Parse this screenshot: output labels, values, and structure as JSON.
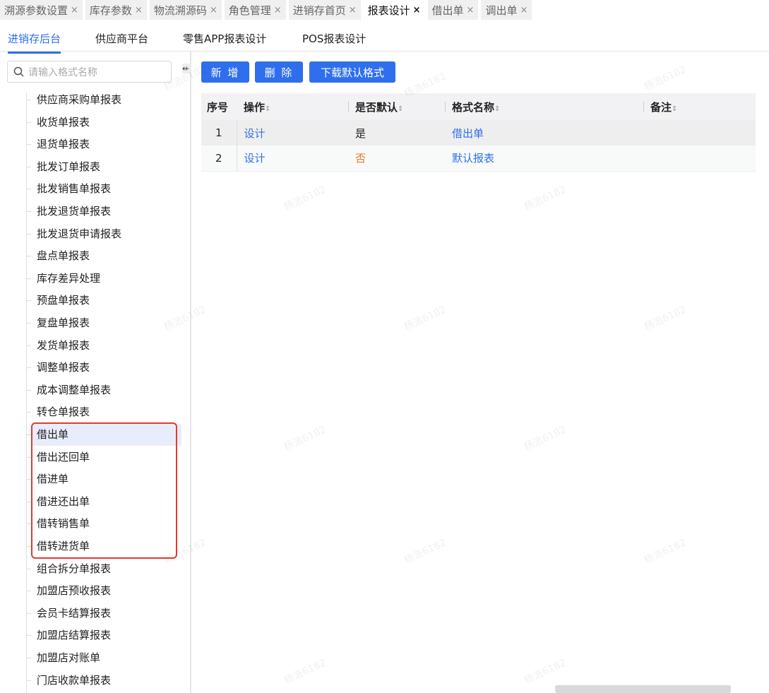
{
  "tabs": [
    {
      "label": "溯源参数设置",
      "active": false
    },
    {
      "label": "库存参数",
      "active": false
    },
    {
      "label": "物流溯源码",
      "active": false
    },
    {
      "label": "角色管理",
      "active": false
    },
    {
      "label": "进销存首页",
      "active": false
    },
    {
      "label": "报表设计",
      "active": true
    },
    {
      "label": "借出单",
      "active": false
    },
    {
      "label": "调出单",
      "active": false
    }
  ],
  "close_glyph": "×",
  "subtabs": [
    "进销存后台",
    "供应商平台",
    "零售APP报表设计",
    "POS报表设计"
  ],
  "search": {
    "placeholder": "请输入格式名称"
  },
  "tree": [
    "供应商采购单报表",
    "收货单报表",
    "退货单报表",
    "批发订单报表",
    "批发销售单报表",
    "批发退货单报表",
    "批发退货申请报表",
    "盘点单报表",
    "库存差异处理",
    "预盘单报表",
    "复盘单报表",
    "发货单报表",
    "调整单报表",
    "成本调整单报表",
    "转仓单报表",
    "借出单",
    "借出还回单",
    "借进单",
    "借进还出单",
    "借转销售单",
    "借转进货单",
    "组合拆分单报表",
    "加盟店预收报表",
    "会员卡结算报表",
    "加盟店结算报表",
    "加盟店对账单",
    "门店收款单报表"
  ],
  "selected_index": 15,
  "toolbar": {
    "add": "新 增",
    "delete": "删 除",
    "download": "下载默认格式"
  },
  "table": {
    "headers": [
      "序号",
      "操作",
      "是否默认",
      "格式名称",
      "备注"
    ],
    "sort_glyph": "⇕",
    "rows": [
      {
        "no": "1",
        "action": "设计",
        "is_default": "是",
        "name": "借出单",
        "remark": ""
      },
      {
        "no": "2",
        "action": "设计",
        "is_default": "否",
        "name": "默认报表",
        "remark": ""
      }
    ]
  },
  "watermark": "杨浩6182",
  "colors": {
    "accent": "#2f6fed",
    "highlight_box": "#e53b2c",
    "no_default": "#e8741f"
  }
}
